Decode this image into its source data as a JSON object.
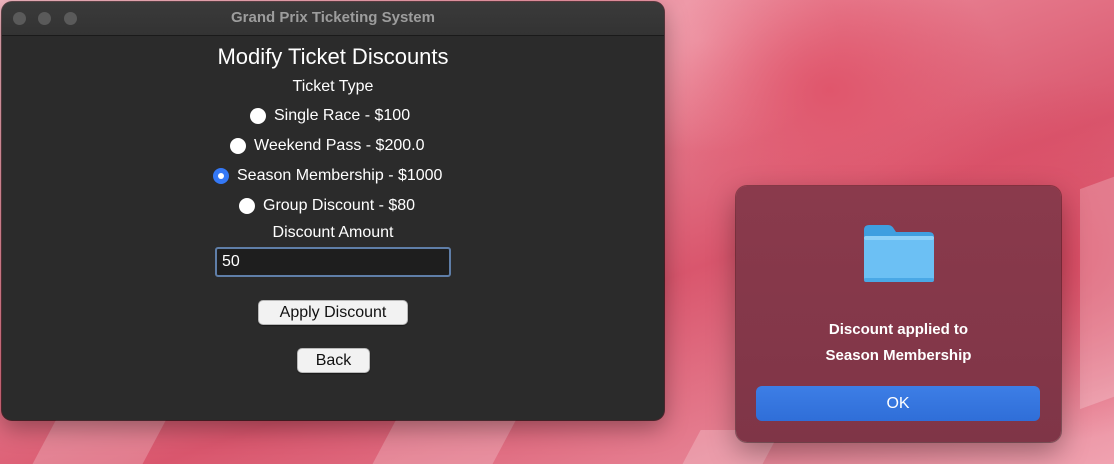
{
  "app_window": {
    "title": "Grand Prix Ticketing System",
    "heading": "Modify Ticket Discounts",
    "ticket_type_label": "Ticket Type",
    "ticket_options": [
      {
        "label": "Single Race - $100",
        "selected": false
      },
      {
        "label": "Weekend Pass - $200.0",
        "selected": false
      },
      {
        "label": "Season Membership - $1000",
        "selected": true
      },
      {
        "label": "Group Discount - $80",
        "selected": false
      }
    ],
    "discount_amount_label": "Discount Amount",
    "discount_amount_value": "50",
    "apply_button_label": "Apply Discount",
    "back_button_label": "Back"
  },
  "alert": {
    "icon": "folder-icon",
    "message_line1": "Discount applied to",
    "message_line2": "Season Membership",
    "ok_button_label": "OK"
  },
  "colors": {
    "accent": "#3478f6",
    "window_background": "#2b2b2b",
    "alert_background": "#8a3a4c"
  }
}
